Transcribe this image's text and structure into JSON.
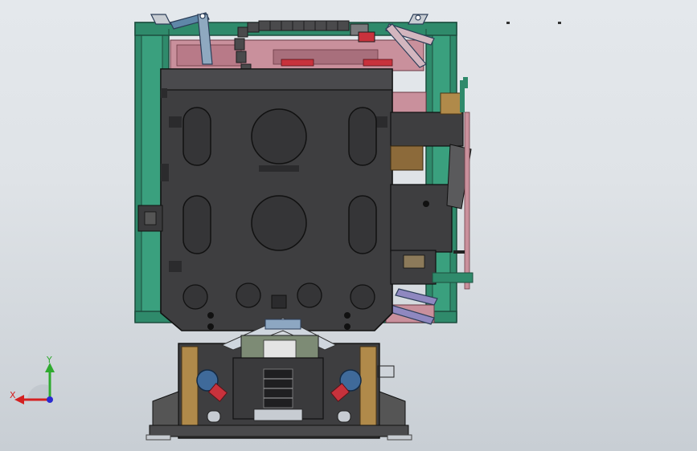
{
  "viewport": {
    "background_top": "#e4e8ec",
    "background_bottom": "#c8ced4",
    "model_view": "front"
  },
  "triad": {
    "x_label": "X",
    "y_label": "Y",
    "x_color": "#d42020",
    "y_color": "#2faa2f",
    "z_color": "#2a2ad0"
  },
  "colors": {
    "frame_green": "#2f8a6b",
    "body_dark": "#3e3e40",
    "pink": "#c9909c",
    "brass": "#b08a4a",
    "steel_blue": "#5f87a8",
    "red_accent": "#c8323c",
    "wood": "#8c6a3a"
  },
  "icons": {
    "triad": "triad-icon"
  }
}
